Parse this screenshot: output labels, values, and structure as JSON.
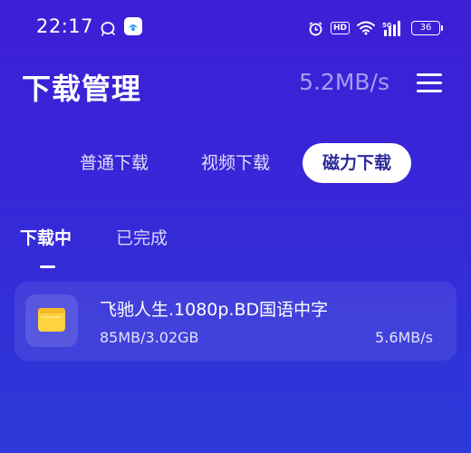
{
  "status_bar": {
    "time": "22:17",
    "hd": "HD",
    "network": "5G",
    "battery": "36"
  },
  "header": {
    "title": "下载管理",
    "speed": "5.2MB/s"
  },
  "category_tabs": [
    {
      "label": "普通下载",
      "active": false
    },
    {
      "label": "视频下载",
      "active": false
    },
    {
      "label": "磁力下载",
      "active": true
    }
  ],
  "status_tabs": [
    {
      "label": "下载中",
      "active": true
    },
    {
      "label": "已完成",
      "active": false
    }
  ],
  "downloads": [
    {
      "name": "飞驰人生.1080p.BD国语中字",
      "progress": "85MB/3.02GB",
      "speed": "5.6MB/s",
      "icon": "folder-icon"
    }
  ],
  "colors": {
    "background_top": "#3d1fd6",
    "background_bottom": "#2b3ad8",
    "active_tab_text": "#2d2b9a",
    "folder": "#ffd23f"
  }
}
